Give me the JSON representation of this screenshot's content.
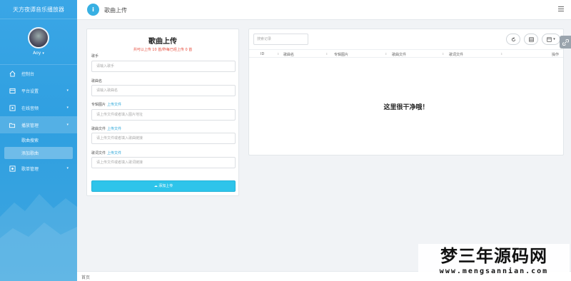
{
  "sidebar": {
    "brand": "天方夜谭音乐播放器",
    "user": "Aoy",
    "items": [
      {
        "label": "控制台",
        "icon": "home-icon"
      },
      {
        "label": "平台设置",
        "icon": "settings-icon"
      },
      {
        "label": "在线音频",
        "icon": "audio-icon"
      },
      {
        "label": "播放管理",
        "icon": "folder-icon"
      },
      {
        "label": "歌单管理",
        "icon": "list-icon"
      }
    ],
    "subitems": [
      {
        "label": "歌曲搜索"
      },
      {
        "label": "添加歌曲"
      }
    ]
  },
  "header": {
    "badge": "i",
    "title": "歌曲上传"
  },
  "upload": {
    "title": "歌曲上传",
    "hint": "共可以上传 10 首/昨每已经上传 0 首",
    "fields": [
      {
        "label": "歌手",
        "placeholder": "请输入歌手"
      },
      {
        "label": "歌曲名",
        "placeholder": "请输入歌曲名"
      },
      {
        "label": "专辑图片",
        "link": "上传文件",
        "placeholder": "请上传文件或者填入图片地址"
      },
      {
        "label": "歌曲文件",
        "link": "上传文件",
        "placeholder": "请上传文件或者填入歌曲链接"
      },
      {
        "label": "歌词文件",
        "link": "上传文件",
        "placeholder": "请上传文件或者填入歌词链接"
      }
    ],
    "submit": "添加上传"
  },
  "table": {
    "search_placeholder": "搜索记录",
    "columns": [
      "ID",
      "歌曲名",
      "专辑图片",
      "歌曲文件",
      "歌词文件",
      "操作"
    ],
    "empty": "这里很干净哦！"
  },
  "footer": {
    "text": "首页"
  },
  "watermark": {
    "title": "梦三年源码网",
    "url": "www.mengsannian.com"
  }
}
